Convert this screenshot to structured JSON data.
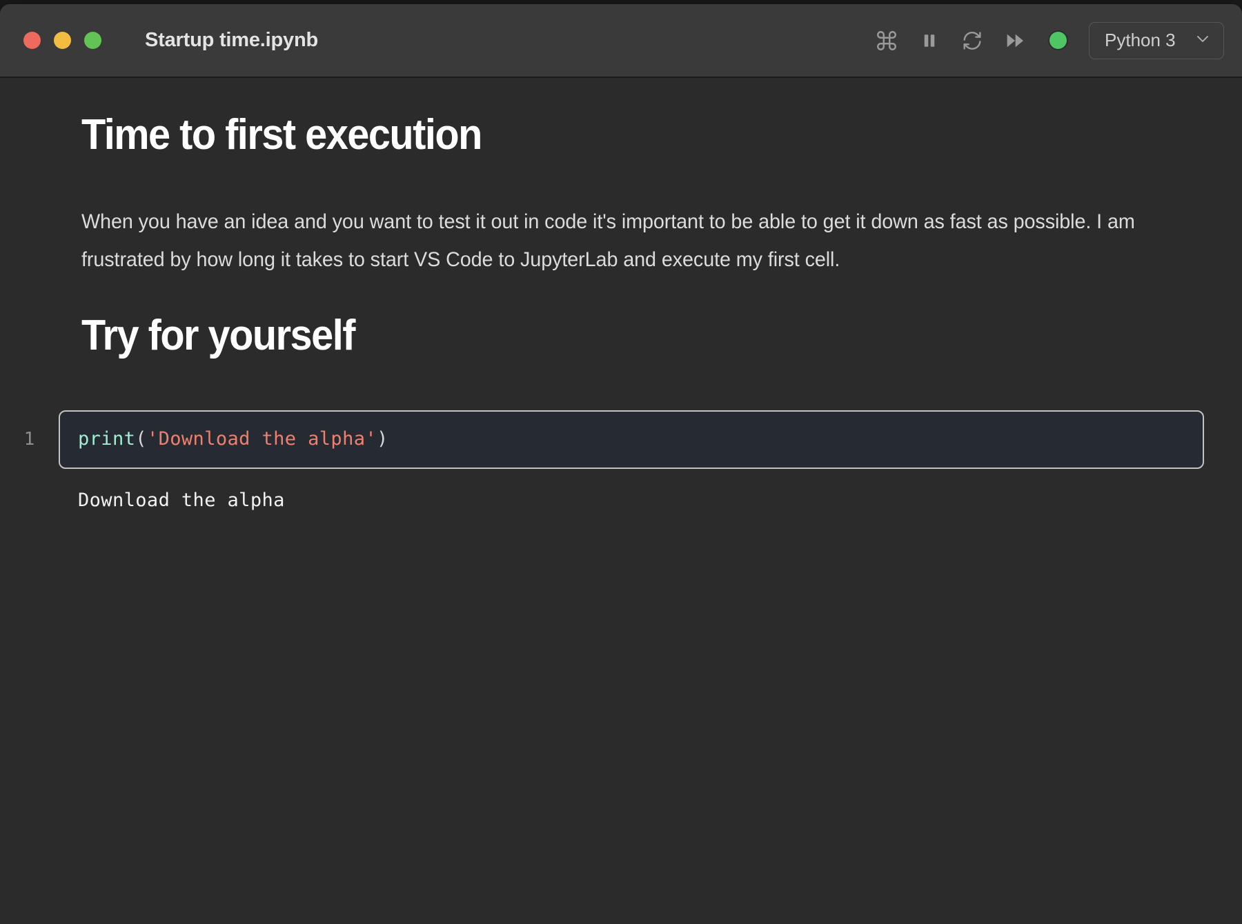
{
  "window": {
    "title": "Startup time.ipynb",
    "traffic_lights": [
      {
        "name": "close",
        "color": "#ec6a5e"
      },
      {
        "name": "minimize",
        "color": "#f2bd41"
      },
      {
        "name": "zoom",
        "color": "#61c454"
      }
    ]
  },
  "toolbar": {
    "command_palette_label": "⌘",
    "interrupt_label": "Interrupt the kernel",
    "restart_label": "Restart the kernel",
    "restart_run_all_label": "Restart the kernel and run all cells",
    "kernel_status": "idle",
    "kernel_status_color": "#4fc663",
    "kernel_name": "Python 3"
  },
  "notebook": {
    "cells": [
      {
        "type": "markdown",
        "heading": "Time to first execution"
      },
      {
        "type": "markdown",
        "paragraph": "When you have an idea and you want to test it out in code it's important to be able to get it down as fast as possible. I am frustrated by how long it takes to start VS Code to JupyterLab and execute my first cell."
      },
      {
        "type": "markdown",
        "heading": "Try for yourself"
      },
      {
        "type": "code",
        "prompt_number": "1",
        "source_tokens": {
          "fn": "print",
          "open_paren": "(",
          "string": "'Download the alpha'",
          "close_paren": ")"
        },
        "source_plain": "print('Download the alpha')",
        "output": "Download the alpha"
      }
    ]
  },
  "colors": {
    "titlebar_bg": "#3a3a3a",
    "notebook_bg": "#2b2b2b",
    "cell_bg": "#262a33",
    "cell_border": "#c3c3c3",
    "code_function": "#9fefd0",
    "code_string": "#f0806d",
    "code_punctuation": "#d6d6d6",
    "output_text": "#f2f2f2",
    "heading_text": "#ffffff",
    "body_text": "#dcdcdc"
  }
}
